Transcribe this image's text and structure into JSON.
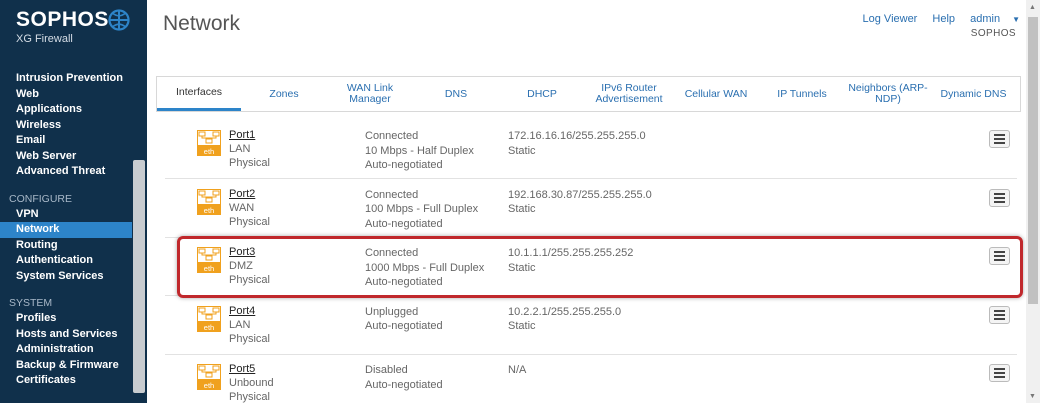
{
  "brand": {
    "name": "SOPHOS",
    "product": "XG Firewall"
  },
  "sidebar": {
    "items_top": [
      "Intrusion Prevention",
      "Web",
      "Applications",
      "Wireless",
      "Email",
      "Web Server",
      "Advanced Threat"
    ],
    "configure_label": "CONFIGURE",
    "configure_items": [
      "VPN",
      "Network",
      "Routing",
      "Authentication",
      "System Services"
    ],
    "system_label": "SYSTEM",
    "system_items": [
      "Profiles",
      "Hosts and Services",
      "Administration",
      "Backup & Firmware",
      "Certificates"
    ],
    "active": "Network"
  },
  "header": {
    "title": "Network",
    "log_viewer": "Log Viewer",
    "help": "Help",
    "user": "admin",
    "company": "SOPHOS"
  },
  "tabs": [
    "Interfaces",
    "Zones",
    "WAN Link Manager",
    "DNS",
    "DHCP",
    "IPv6 Router Advertisement",
    "Cellular WAN",
    "IP Tunnels",
    "Neighbors (ARP-NDP)",
    "Dynamic DNS"
  ],
  "active_tab": "Interfaces",
  "interfaces": [
    {
      "name": "Port1",
      "zone": "LAN",
      "type": "Physical",
      "status": "Connected",
      "speed": "10 Mbps - Half Duplex",
      "negotiation": "Auto-negotiated",
      "ip": "172.16.16.16/255.255.255.0",
      "mode": "Static"
    },
    {
      "name": "Port2",
      "zone": "WAN",
      "type": "Physical",
      "status": "Connected",
      "speed": "100 Mbps - Full Duplex",
      "negotiation": "Auto-negotiated",
      "ip": "192.168.30.87/255.255.255.0",
      "mode": "Static"
    },
    {
      "name": "Port3",
      "zone": "DMZ",
      "type": "Physical",
      "status": "Connected",
      "speed": "1000 Mbps - Full Duplex",
      "negotiation": "Auto-negotiated",
      "ip": "10.1.1.1/255.255.255.252",
      "mode": "Static"
    },
    {
      "name": "Port4",
      "zone": "LAN",
      "type": "Physical",
      "status": "Unplugged",
      "speed": "",
      "negotiation": "Auto-negotiated",
      "ip": "10.2.2.1/255.255.255.0",
      "mode": "Static"
    },
    {
      "name": "Port5",
      "zone": "Unbound",
      "type": "Physical",
      "status": "Disabled",
      "speed": "",
      "negotiation": "Auto-negotiated",
      "ip": "N/A",
      "mode": ""
    }
  ],
  "icon_label": "eth",
  "colors": {
    "sidebar": "#10304b",
    "accent": "#2d84c9",
    "eth_icon": "#f0a11e",
    "highlight": "#c0282c"
  }
}
